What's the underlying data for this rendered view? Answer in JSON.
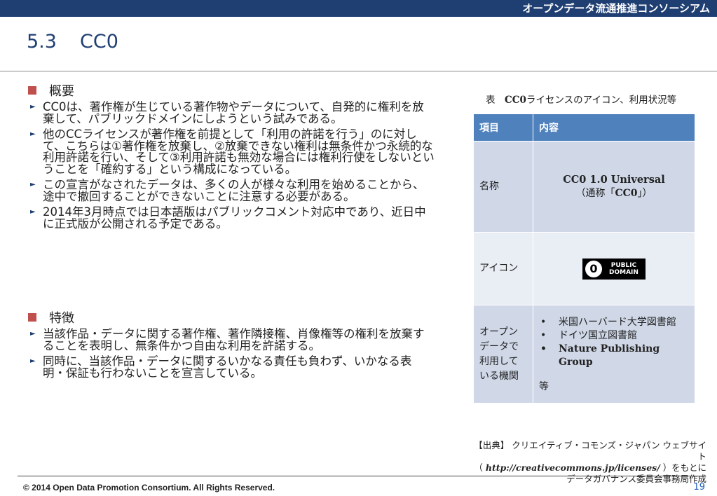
{
  "header": {
    "organization": "オープンデータ流通推進コンソーシアム",
    "section_number": "5.3",
    "section_title": "CC0"
  },
  "sections": [
    {
      "heading": "概要",
      "bullets": [
        "CC0は、著作権が生じている著作物やデータについて、自発的に権利を放棄して、パブリックドメインにしようという試みである。",
        "他のCCライセンスが著作権を前提として「利用の許諾を行う」のに対して、こちらは①著作権を放棄し、②放棄できない権利は無条件かつ永続的な利用許諾を行い、そして③利用許諾も無効な場合には権利行使をしないということを「確約する」という構成になっている。",
        "この宣言がなされたデータは、多くの人が様々な利用を始めることから、途中で撤回することができないことに注意する必要がある。",
        "2014年3月時点では日本語版はパブリックコメント対応中であり、近日中に正式版が公開される予定である。"
      ]
    },
    {
      "heading": "特徴",
      "bullets": [
        "当該作品・データに関する著作権、著作隣接権、肖像権等の権利を放棄することを表明し、無条件かつ自由な利用を許諾する。",
        "同時に、当該作品・データに関するいかなる責任も負わず、いかなる表明・保証も行わないことを宣言している。"
      ]
    }
  ],
  "table": {
    "caption_prefix": "表",
    "caption_bold": "CC0",
    "caption_rest": "ライセンスのアイコン、利用状況等",
    "col_headers": [
      "項目",
      "内容"
    ],
    "rows": {
      "name": {
        "label": "名称",
        "main": "CC0 1.0 Universal",
        "sub_prefix": "（通称「",
        "sub_bold": "CC0",
        "sub_suffix": "」）"
      },
      "icon": {
        "label": "アイコン",
        "logo_glyph": "0",
        "logo_line1": "PUBLIC",
        "logo_line2": "DOMAIN"
      },
      "orgs": {
        "label": "オープンデータで利用している機関",
        "items": [
          "米国ハーバード大学図書館",
          "ドイツ国立図書館",
          "Nature Publishing Group"
        ],
        "etc": "等"
      }
    }
  },
  "source": {
    "line1": "【出典】 クリエイティブ・コモンズ・ジャパン ウェブサイト",
    "url_open": "（ ",
    "url": "http://creativecommons.jp/licenses/",
    "url_close": " ）をもとに",
    "line3": "データガバナンス委員会事務局作成"
  },
  "footer": {
    "copyright": "© 2014 Open Data Promotion Consortium. All Rights Reserved.",
    "page_number": "19"
  },
  "colors": {
    "header_bar": "#1f3f73",
    "bullet_square": "#c0504d",
    "table_header": "#4f81bd",
    "table_cell": "#d0d8e8",
    "table_cell_alt": "#e9edf4",
    "page_number": "#1f5fbf"
  }
}
